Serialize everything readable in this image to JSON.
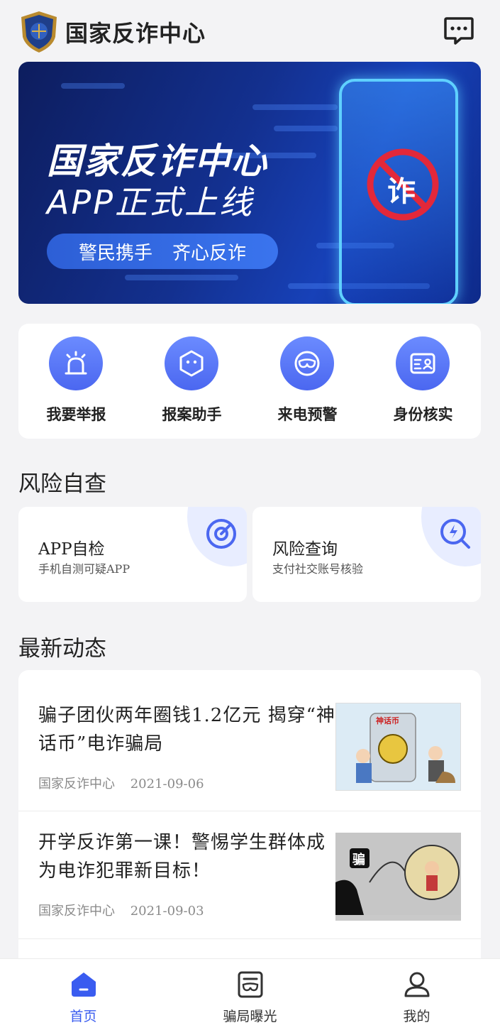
{
  "header": {
    "title": "国家反诈中心",
    "logo_icon": "police-badge-icon",
    "message_icon": "message-bubble-icon"
  },
  "banner": {
    "title": "国家反诈中心",
    "subtitle": "APP正式上线",
    "slogan_left": "警民携手",
    "slogan_right": "齐心反诈",
    "badge_char": "诈"
  },
  "quick_actions": [
    {
      "label": "我要举报",
      "icon": "alarm-light-icon"
    },
    {
      "label": "报案助手",
      "icon": "hexagon-bot-icon"
    },
    {
      "label": "来电预警",
      "icon": "mask-icon"
    },
    {
      "label": "身份核实",
      "icon": "id-card-icon"
    }
  ],
  "risk_section": {
    "title": "风险自查",
    "cards": [
      {
        "title": "APP自检",
        "desc": "手机自测可疑APP",
        "icon": "target-icon"
      },
      {
        "title": "风险查询",
        "desc": "支付社交账号核验",
        "icon": "lightning-search-icon"
      }
    ]
  },
  "news_section": {
    "title": "最新动态",
    "items": [
      {
        "title": "骗子团伙两年圈钱1.2亿元 揭穿“神话币”电诈骗局",
        "source": "国家反诈中心",
        "date": "2021-09-06",
        "thumb_label": "神话币"
      },
      {
        "title": "开学反诈第一课！警惕学生群体成为电诈犯罪新目标！",
        "source": "国家反诈中心",
        "date": "2021-09-03",
        "thumb_label": "骗"
      }
    ]
  },
  "tabbar": {
    "items": [
      {
        "label": "首页",
        "icon": "home-icon",
        "active": true
      },
      {
        "label": "骗局曝光",
        "icon": "document-mask-icon",
        "active": false
      },
      {
        "label": "我的",
        "icon": "user-icon",
        "active": false
      }
    ]
  },
  "colors": {
    "accent": "#4b67f0",
    "background": "#f3f3f5",
    "banner_dark": "#0d1d5e"
  }
}
